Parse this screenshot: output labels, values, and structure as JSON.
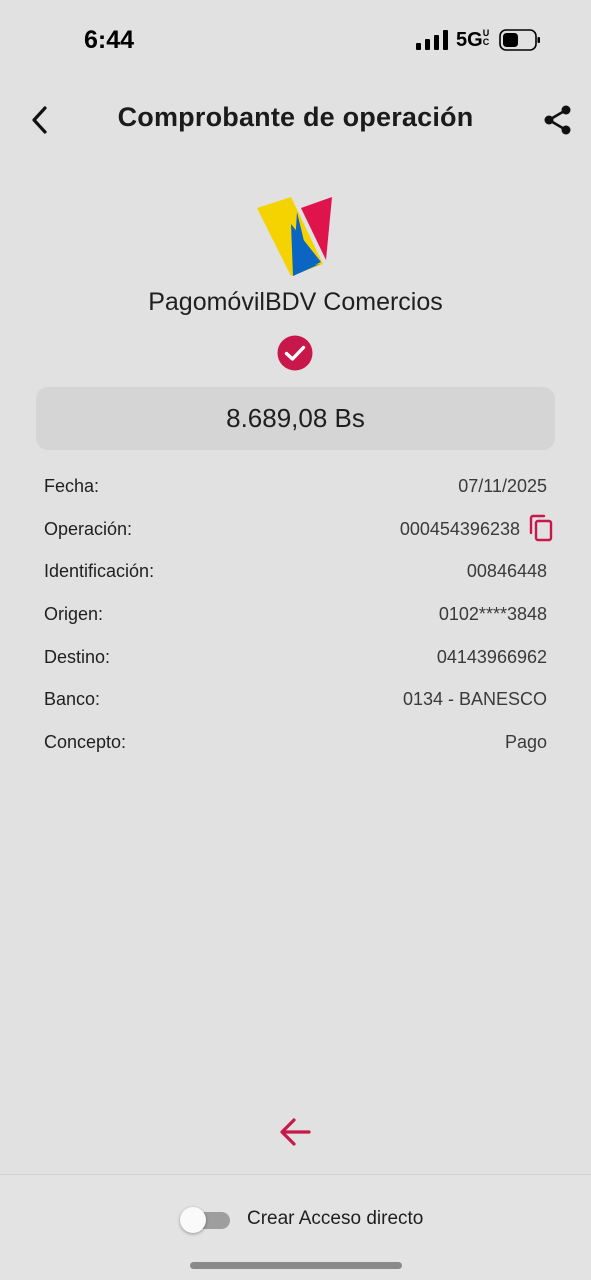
{
  "status_bar": {
    "time": "6:44",
    "network": "5G",
    "network_suffix": "UC"
  },
  "header": {
    "title": "Comprobante de operación"
  },
  "brand": {
    "name": "PagomóvilBDV Comercios"
  },
  "amount": "8.689,08 Bs",
  "details": [
    {
      "label": "Fecha:",
      "value": "07/11/2025"
    },
    {
      "label": "Operación:",
      "value": "000454396238"
    },
    {
      "label": "Identificación:",
      "value": "00846448"
    },
    {
      "label": "Origen:",
      "value": "0102****3848"
    },
    {
      "label": "Destino:",
      "value": "04143966962"
    },
    {
      "label": "Banco:",
      "value": "0134 - BANESCO"
    },
    {
      "label": "Concepto:",
      "value": "Pago"
    }
  ],
  "footer": {
    "toggle_label": "Crear Acceso directo",
    "toggle_on": false
  },
  "icons": {
    "back": "chevron-left-icon",
    "share": "share-icon",
    "check": "check-circle-icon",
    "copy": "copy-icon",
    "bottom_back": "arrow-left-icon"
  },
  "colors": {
    "background": "#e1e1e1",
    "accent": "#c8174a",
    "logo_yellow": "#f5d300",
    "logo_blue": "#0a66c2",
    "logo_red": "#e0144c"
  }
}
